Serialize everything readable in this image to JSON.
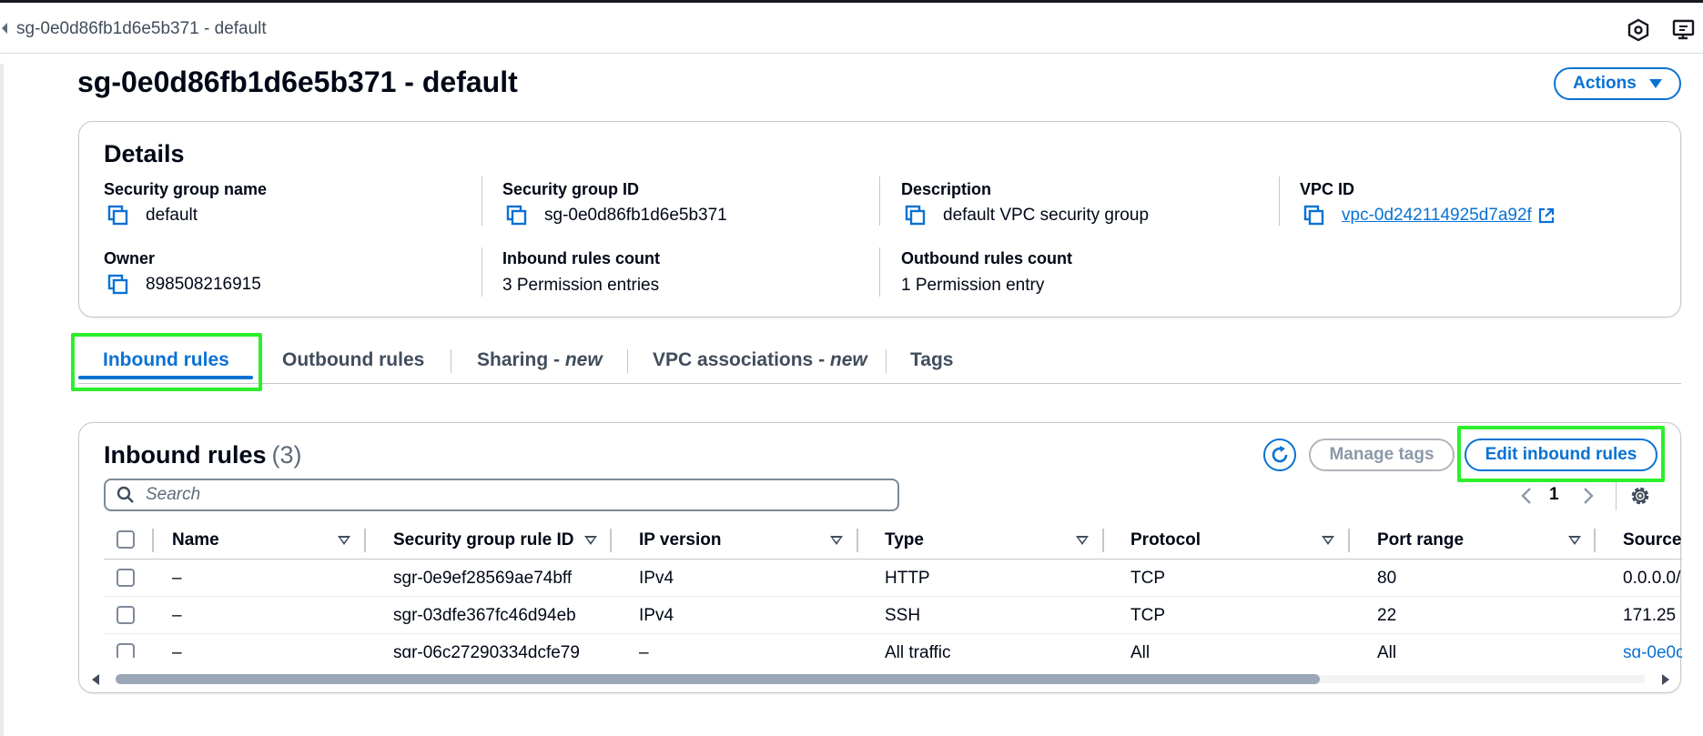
{
  "topbar": {
    "title": "sg-0e0d86fb1d6e5b371 - default",
    "icons": [
      "settings-hex-icon",
      "feedback-icon"
    ]
  },
  "page": {
    "title": "sg-0e0d86fb1d6e5b371 - default",
    "actions_label": "Actions"
  },
  "details": {
    "title": "Details",
    "fields": {
      "sg_name": {
        "label": "Security group name",
        "value": "default"
      },
      "sg_id": {
        "label": "Security group ID",
        "value": "sg-0e0d86fb1d6e5b371"
      },
      "description": {
        "label": "Description",
        "value": "default VPC security group"
      },
      "vpc_id": {
        "label": "VPC ID",
        "value": "vpc-0d242114925d7a92f"
      },
      "owner": {
        "label": "Owner",
        "value": "898508216915"
      },
      "inbound_count": {
        "label": "Inbound rules count",
        "value": "3 Permission entries"
      },
      "outbound_count": {
        "label": "Outbound rules count",
        "value": "1 Permission entry"
      }
    }
  },
  "tabs": {
    "inbound": "Inbound rules",
    "outbound": "Outbound rules",
    "sharing": "Sharing - ",
    "sharing_new": "new",
    "vpc_assoc": "VPC associations - ",
    "vpc_assoc_new": "new",
    "tags": "Tags",
    "active": "inbound"
  },
  "rules": {
    "title": "Inbound rules",
    "count": "(3)",
    "manage_tags_label": "Manage tags",
    "edit_label": "Edit inbound rules",
    "search_placeholder": "Search",
    "page_number": "1",
    "columns": {
      "name": "Name",
      "rule_id": "Security group rule ID",
      "ip_version": "IP version",
      "type": "Type",
      "protocol": "Protocol",
      "port_range": "Port range",
      "source": "Source"
    },
    "rows": [
      {
        "name": "–",
        "rule_id": "sgr-0e9ef28569ae74bff",
        "ip_version": "IPv4",
        "type": "HTTP",
        "protocol": "TCP",
        "port_range": "80",
        "source": "0.0.0.0/"
      },
      {
        "name": "–",
        "rule_id": "sgr-03dfe367fc46d94eb",
        "ip_version": "IPv4",
        "type": "SSH",
        "protocol": "TCP",
        "port_range": "22",
        "source": "171.25"
      },
      {
        "name": "–",
        "rule_id": "sgr-06c27290334dcfe79",
        "ip_version": "–",
        "type": "All traffic",
        "protocol": "All",
        "port_range": "All",
        "source": "sg-0e0c"
      }
    ]
  },
  "colors": {
    "accent": "#0972d3",
    "highlight": "#2bef2b",
    "text": "#000716",
    "border": "#c6c6cd"
  }
}
